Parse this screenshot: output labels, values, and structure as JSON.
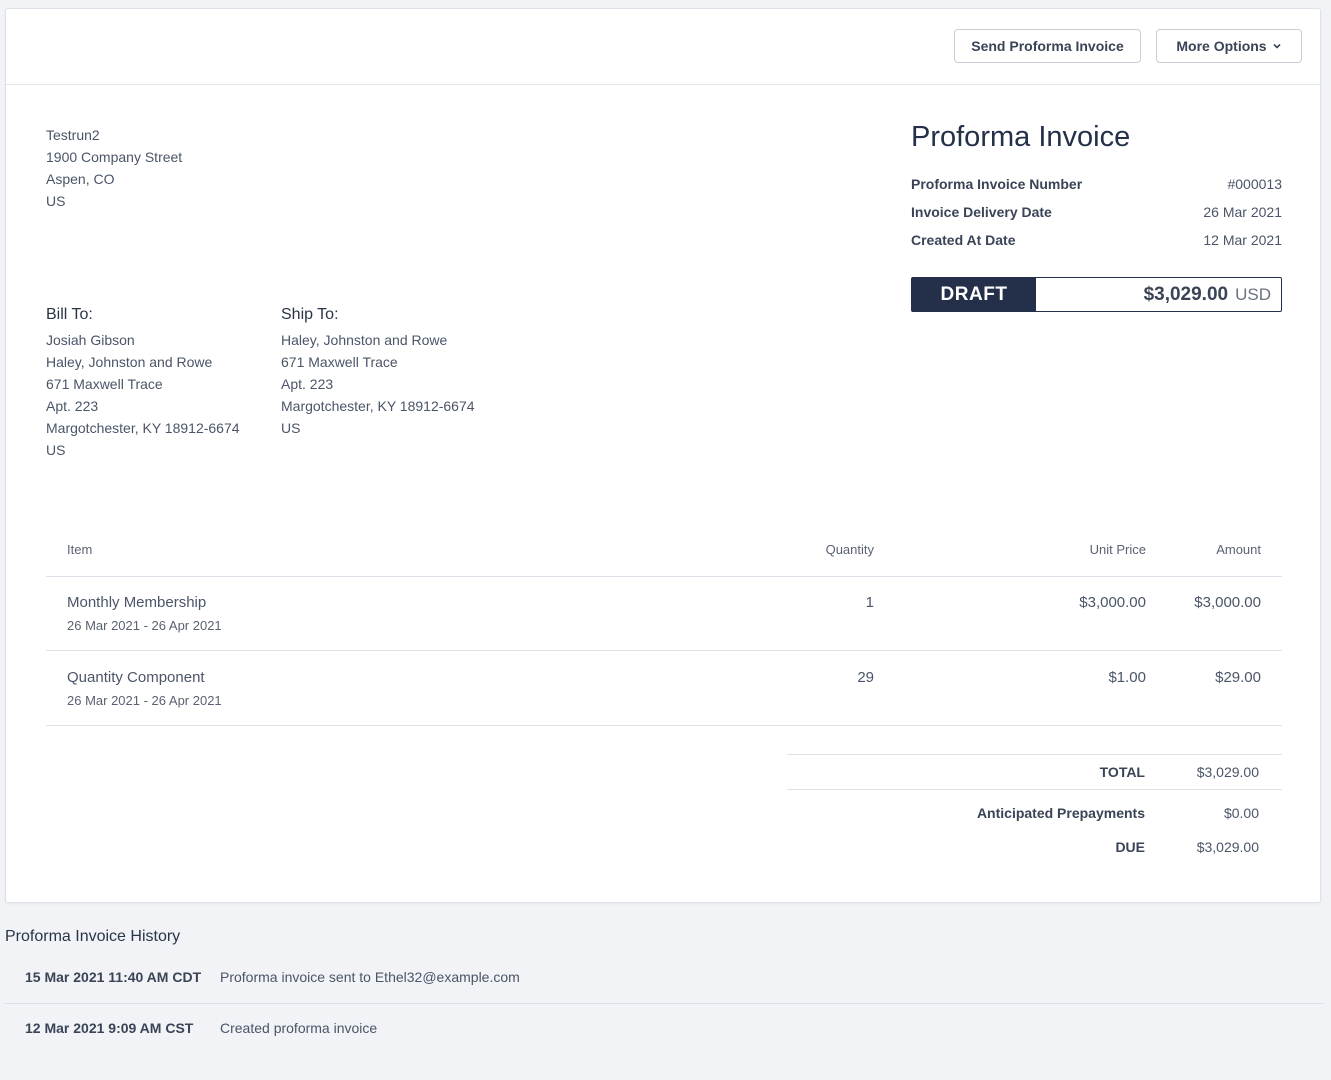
{
  "toolbar": {
    "send_label": "Send Proforma Invoice",
    "more_label": "More Options"
  },
  "seller": {
    "lines": [
      "Testrun2",
      "1900 Company Street",
      "Aspen, CO",
      "US"
    ]
  },
  "bill_to": {
    "heading": "Bill To:",
    "lines": [
      "Josiah Gibson",
      "Haley, Johnston and Rowe",
      "671 Maxwell Trace",
      "Apt. 223",
      "Margotchester, KY 18912-6674",
      "US"
    ]
  },
  "ship_to": {
    "heading": "Ship To:",
    "lines": [
      "Haley, Johnston and Rowe",
      "671 Maxwell Trace",
      "Apt. 223",
      "Margotchester, KY 18912-6674",
      "US"
    ]
  },
  "invoice": {
    "title": "Proforma Invoice",
    "meta": [
      {
        "label": "Proforma Invoice Number",
        "value": "#000013"
      },
      {
        "label": "Invoice Delivery Date",
        "value": "26 Mar 2021"
      },
      {
        "label": "Created At Date",
        "value": "12 Mar 2021"
      }
    ],
    "status": "DRAFT",
    "amount": "$3,029.00",
    "currency": "USD"
  },
  "table": {
    "headers": {
      "item": "Item",
      "quantity": "Quantity",
      "unit_price": "Unit Price",
      "amount": "Amount"
    },
    "rows": [
      {
        "item": "Monthly Membership",
        "period": "26 Mar 2021 - 26 Apr 2021",
        "quantity": "1",
        "unit_price": "$3,000.00",
        "amount": "$3,000.00"
      },
      {
        "item": "Quantity Component",
        "period": "26 Mar 2021 - 26 Apr 2021",
        "quantity": "29",
        "unit_price": "$1.00",
        "amount": "$29.00"
      }
    ]
  },
  "totals": {
    "total_label": "TOTAL",
    "total_value": "$3,029.00",
    "prepay_label": "Anticipated Prepayments",
    "prepay_value": "$0.00",
    "due_label": "DUE",
    "due_value": "$3,029.00"
  },
  "history": {
    "title": "Proforma Invoice History",
    "entries": [
      {
        "timestamp": "15 Mar 2021 11:40 AM CDT",
        "message": "Proforma invoice sent to Ethel32@example.com"
      },
      {
        "timestamp": "12 Mar 2021 9:09 AM CST",
        "message": "Created proforma invoice"
      }
    ]
  },
  "colors": {
    "accent": "#243049",
    "background": "#f1f3f6",
    "card": "#ffffff"
  },
  "icons": {
    "more_options": "chevron-down-icon"
  }
}
